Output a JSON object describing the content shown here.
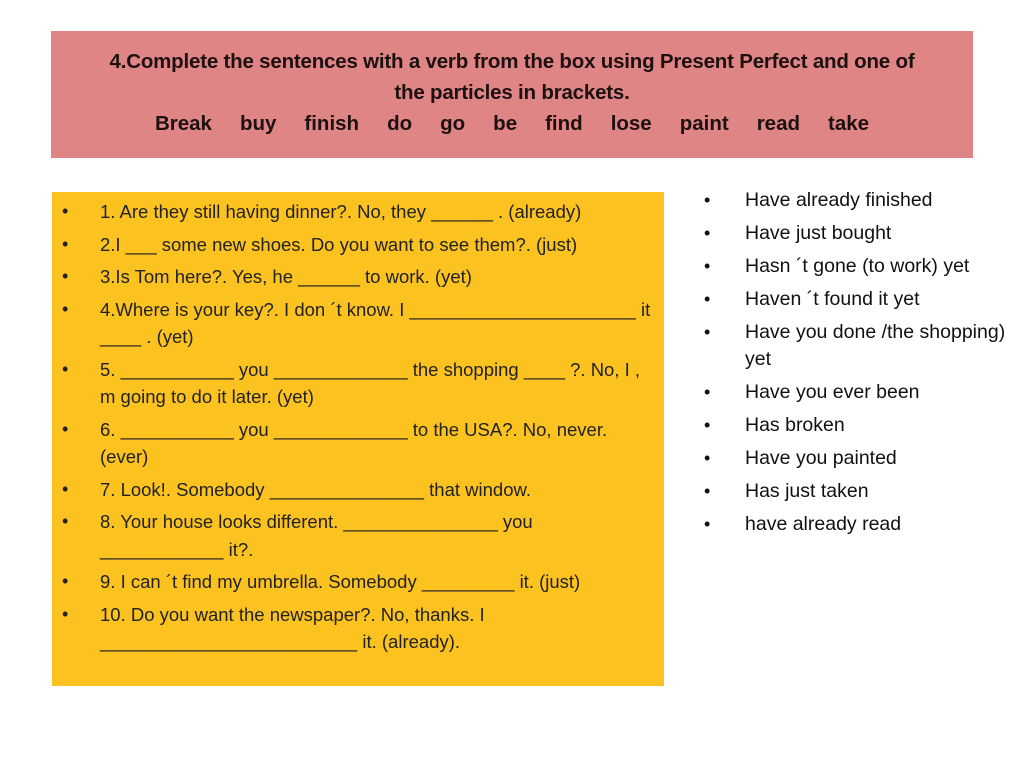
{
  "header": {
    "title_line1": "4.Complete the sentences with a verb from the box using Present Perfect and one of",
    "title_line2": "the particles in brackets.",
    "verbs": [
      "Break",
      "buy",
      "finish",
      "do",
      "go",
      "be",
      "find",
      "lose",
      "paint",
      "read",
      "take"
    ]
  },
  "colors": {
    "header_bg": "#e08585",
    "exercise_bg": "#fcc320",
    "page_bg": "#ffffff"
  },
  "bullet_char": "•",
  "exercises": [
    "1. Are they still having dinner?. No, they ______ . (already)",
    "2.I ___ some new shoes. Do you want to see them?.  (just)",
    "3.Is Tom here?. Yes, he ______ to work.  (yet)",
    "4.Where is your key?. I don ´t know. I ______________________ it ____ . (yet)",
    "5. ___________ you _____________ the shopping  ____ ?. No, I , m going to do it later. (yet)",
    "6. ___________ you _____________ to the USA?. No, never. (ever)",
    "7. Look!. Somebody _______________ that window.",
    "8. Your house looks different. _______________ you ____________ it?.",
    "9. I can ´t find my umbrella. Somebody _________ it. (just)",
    "10. Do you want the newspaper?. No, thanks. I _________________________ it. (already)."
  ],
  "answers": [
    "Have already finished",
    "Have just bought",
    "Hasn ´t gone (to work) yet",
    "Haven ´t found it yet",
    "Have you done /the shopping) yet",
    "Have you ever been",
    "Has broken",
    "Have you painted",
    "Has just taken",
    "have already read"
  ]
}
